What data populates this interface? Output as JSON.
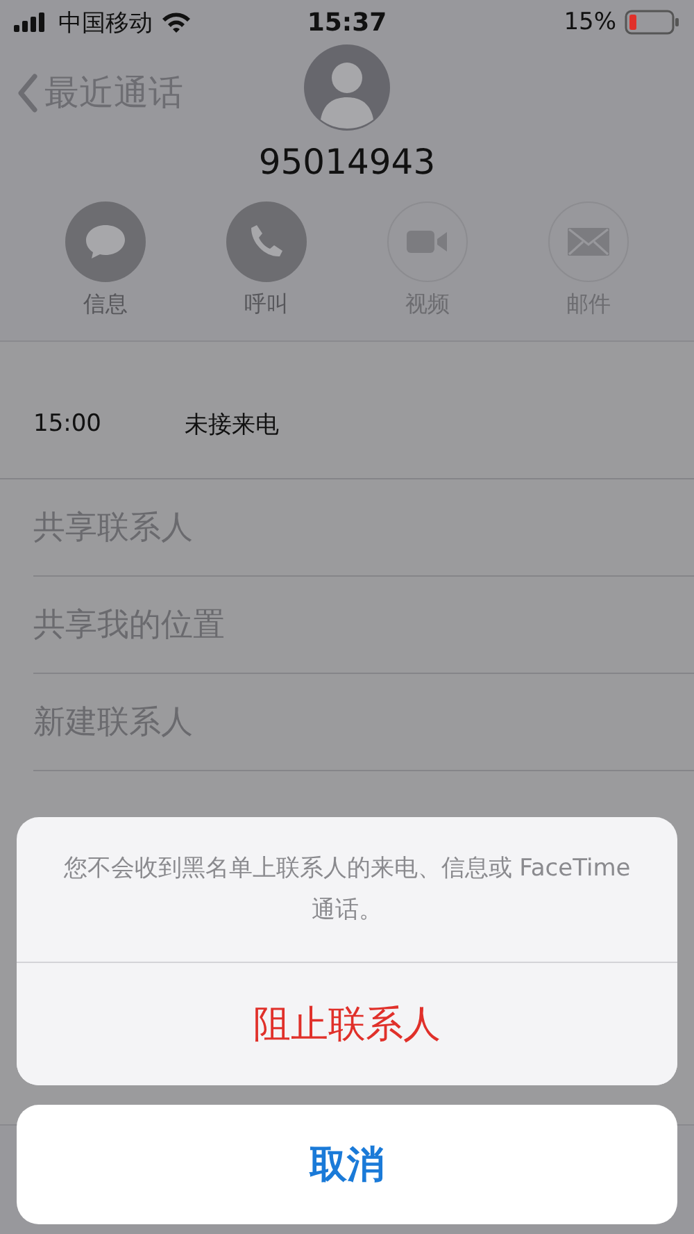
{
  "status_bar": {
    "carrier": "中国移动",
    "time": "15:37",
    "battery_text": "15%"
  },
  "nav": {
    "back_label": "最近通话"
  },
  "contact": {
    "number": "95014943"
  },
  "actions": [
    {
      "kind": "message",
      "label": "信息",
      "disabled": false
    },
    {
      "kind": "phone",
      "label": "呼叫",
      "disabled": false
    },
    {
      "kind": "video",
      "label": "视频",
      "disabled": true
    },
    {
      "kind": "mail",
      "label": "邮件",
      "disabled": true
    }
  ],
  "call_history": {
    "time": "15:00",
    "type": "未接来电"
  },
  "menu_items": [
    "共享联系人",
    "共享我的位置",
    "新建联系人"
  ],
  "action_sheet": {
    "message": "您不会收到黑名单上联系人的来电、信息或 FaceTime 通话。",
    "destructive_button": "阻止联系人",
    "cancel_button": "取消"
  }
}
